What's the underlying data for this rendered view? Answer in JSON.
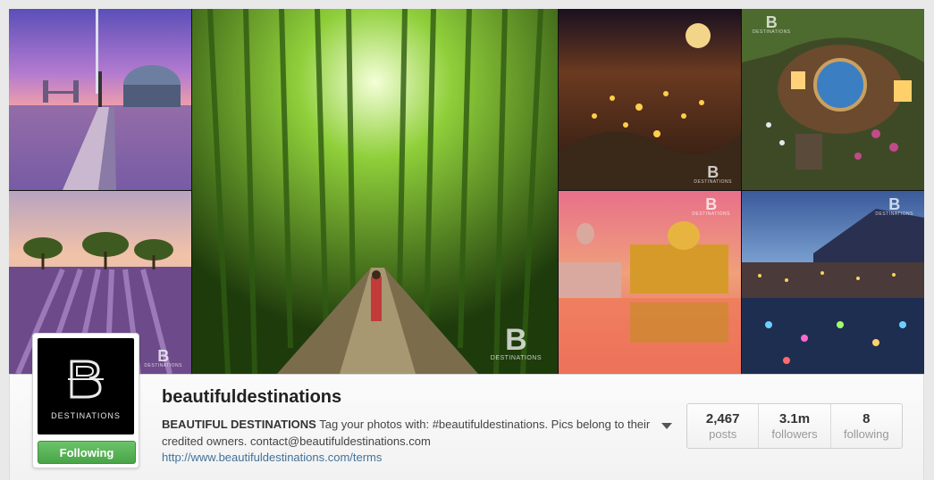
{
  "profile": {
    "username": "beautifuldestinations",
    "bio_name": "BEAUTIFUL DESTINATIONS",
    "bio_text": " Tag your photos with: #beautifuldestinations. Pics belong to their credited owners. contact@beautifuldestinations.com",
    "website": "http://www.beautifuldestinations.com/terms",
    "avatar_text": "DESTINATIONS",
    "follow_label": "Following"
  },
  "stats": [
    {
      "value": "2,467",
      "label": "posts"
    },
    {
      "value": "3.1m",
      "label": "followers"
    },
    {
      "value": "8",
      "label": "following"
    }
  ],
  "watermark": {
    "letter": "B",
    "text": "DESTINATIONS"
  },
  "tiles": [
    {
      "name": "photo-london-thames",
      "subject": "London Thames at sunset"
    },
    {
      "name": "photo-bamboo-forest",
      "subject": "Bamboo forest path"
    },
    {
      "name": "photo-night-village-moon",
      "subject": "Night town under full moon"
    },
    {
      "name": "photo-hobbit-house",
      "subject": "Hobbit house with flowers"
    },
    {
      "name": "photo-lavender-field",
      "subject": "Lavender field with trees"
    },
    {
      "name": "photo-golden-temple",
      "subject": "Golden temple reflection"
    },
    {
      "name": "photo-lakeside-lanterns",
      "subject": "Lakeside town with lanterns"
    }
  ],
  "colors": {
    "follow_green": "#4aa448",
    "link_blue": "#3f729b"
  }
}
